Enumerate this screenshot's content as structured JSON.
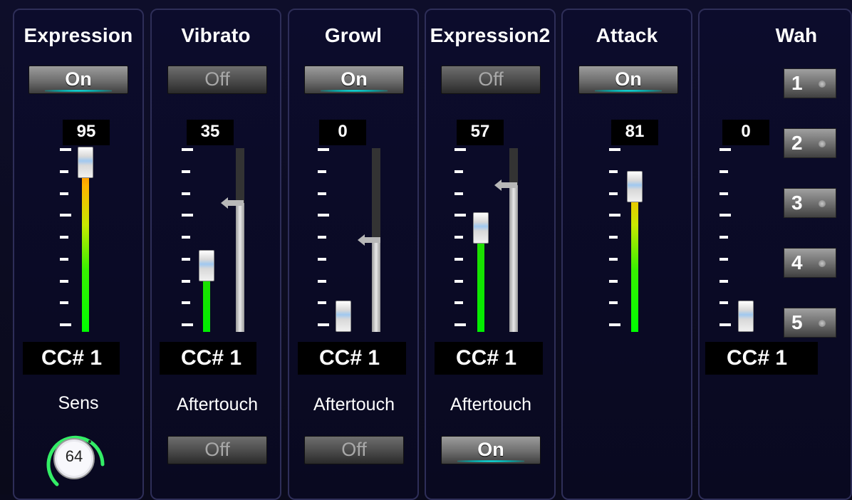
{
  "channels": [
    {
      "title": "Expression",
      "toggle": "On",
      "value": "95",
      "cc": "CC# 1",
      "sens_label": "Sens",
      "sens_value": "64",
      "level": 0.95
    },
    {
      "title": "Vibrato",
      "toggle": "Off",
      "value": "35",
      "cc": "CC# 1",
      "aftertouch_label": "Aftertouch",
      "aftertouch_toggle": "Off",
      "level": 0.35,
      "aftertouch_level": 0.7
    },
    {
      "title": "Growl",
      "toggle": "On",
      "value": "0",
      "cc": "CC# 1",
      "aftertouch_label": "Aftertouch",
      "aftertouch_toggle": "Off",
      "level": 0.0,
      "aftertouch_level": 0.5
    },
    {
      "title": "Expression2",
      "toggle": "Off",
      "value": "57",
      "cc": "CC# 1",
      "aftertouch_label": "Aftertouch",
      "aftertouch_toggle": "On",
      "level": 0.57,
      "aftertouch_level": 0.8
    },
    {
      "title": "Attack",
      "toggle": "On",
      "value": "81",
      "level": 0.81
    },
    {
      "title": "Wah",
      "value": "0",
      "cc": "CC# 1",
      "level": 0.0,
      "presets": [
        "1",
        "2",
        "3",
        "4",
        "5"
      ]
    }
  ],
  "colors": {
    "accent": "#22ffff",
    "panel_border": "#2e2e58",
    "knob_arc": "#33ee66"
  }
}
